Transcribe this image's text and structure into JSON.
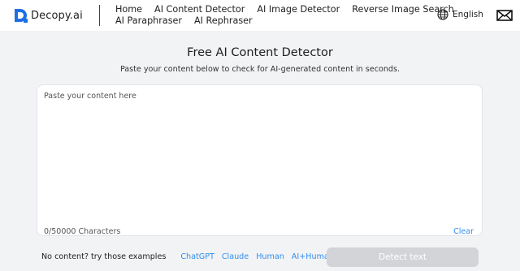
{
  "header": {
    "logo_text": "Decopy.ai",
    "nav": [
      "Home",
      "AI Content Detector",
      "AI Image Detector",
      "Reverse Image Search",
      "AI Paraphraser",
      "AI Rephraser"
    ],
    "language": "English",
    "icons": {
      "logo": "decopy-logo-icon",
      "language": "globe-icon",
      "contact": "mail-icon"
    }
  },
  "main": {
    "title": "Free AI Content Detector",
    "subtitle": "Paste your content below to check for AI-generated content in seconds.",
    "editor": {
      "placeholder": "Paste your content here",
      "value": "",
      "counter": "0/50000 Characters",
      "clear_label": "Clear"
    },
    "examples": {
      "label": "No content? try those examples",
      "links": [
        "ChatGPT",
        "Claude",
        "Human",
        "AI+Human"
      ]
    },
    "detect_button": "Detect text"
  },
  "colors": {
    "accent": "#2f8ef0",
    "logo_blue": "#1f6fe5",
    "page_bg": "#f2f3f5",
    "button_disabled": "#d2d4d8"
  }
}
